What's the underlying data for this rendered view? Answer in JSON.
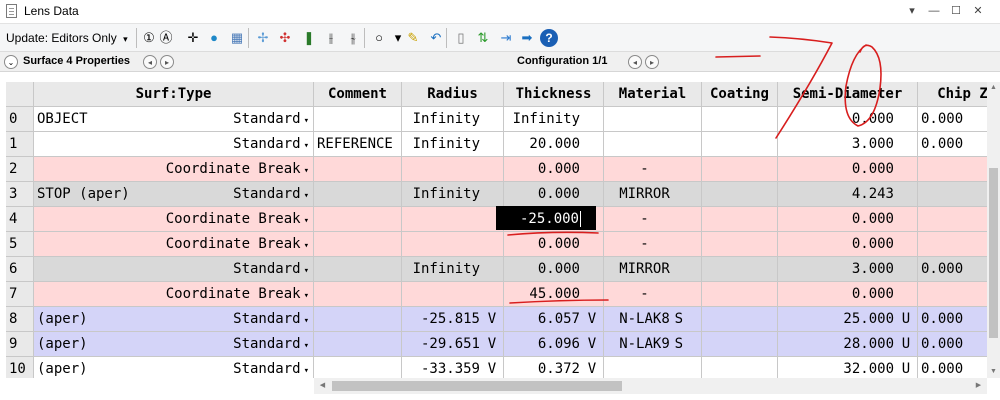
{
  "window": {
    "title": "Lens Data",
    "controls": [
      "▾",
      "—",
      "☐",
      "✕"
    ]
  },
  "toolbar": {
    "update_label": "Update: Editors Only",
    "dropdown_glyph": "▾",
    "icons": [
      {
        "name": "constant-1-icon",
        "glyph": "①",
        "color": "#000000"
      },
      {
        "name": "constant-a-icon",
        "glyph": "Ⓐ",
        "color": "#000000"
      },
      {
        "name": "crosshair-icon",
        "glyph": "✛",
        "color": "#000000"
      },
      {
        "name": "globe-icon",
        "glyph": "●",
        "color": "#1e88c8"
      },
      {
        "name": "map-icon",
        "glyph": "▦",
        "color": "#4a7ab8"
      },
      {
        "name": "insert-surface-icon",
        "glyph": "✢",
        "color": "#5b9bd5"
      },
      {
        "name": "delete-surface-icon",
        "glyph": "✣",
        "color": "#d03030"
      },
      {
        "name": "lens-group-icon",
        "glyph": "❚",
        "color": "#2a7a2a"
      },
      {
        "name": "fold-mirror-icon",
        "glyph": "⫲",
        "color": "#333333"
      },
      {
        "name": "tilt-decenter-icon",
        "glyph": "⫳",
        "color": "#333333"
      },
      {
        "name": "ring-icon",
        "glyph": "○",
        "color": "#000000"
      },
      {
        "name": "dropdown-arrow-icon",
        "glyph": "▾",
        "color": "#000000"
      },
      {
        "name": "edit-pencil-icon",
        "glyph": "✎",
        "color": "#c8a000"
      },
      {
        "name": "undo-arrow-icon",
        "glyph": "↶",
        "color": "#1a6fc0"
      },
      {
        "name": "page-icon",
        "glyph": "▯",
        "color": "#777777"
      },
      {
        "name": "swap-arrows-icon",
        "glyph": "⇅",
        "color": "#2a9a2a"
      },
      {
        "name": "arrows-in-icon",
        "glyph": "⇥",
        "color": "#2a7ad0"
      },
      {
        "name": "right-arrow-icon",
        "glyph": "➡",
        "color": "#1a6fc0"
      },
      {
        "name": "help-icon",
        "glyph": "?",
        "color": "#ffffff"
      }
    ]
  },
  "subbar": {
    "collapse_glyph": "⌄",
    "properties_label": "Surface 4 Properties",
    "configuration_label": "Configuration 1/1",
    "prev_glyph": "◂",
    "next_glyph": "▸"
  },
  "table": {
    "columns": [
      "Surf:Type",
      "Comment",
      "Radius",
      "Thickness",
      "Material",
      "Coating",
      "Semi-Diameter",
      "Chip Z"
    ],
    "rows": [
      {
        "idx": "0",
        "name": "OBJECT",
        "type": "Standard",
        "comment": "",
        "radius": "Infinity",
        "radius_flag": "",
        "thickness": "Infinity",
        "thickness_flag": "",
        "material": "",
        "material_flag": "",
        "coating": "",
        "semi": "0.000",
        "semi_flag": "",
        "chip": "0.000",
        "bg": "#ffffff"
      },
      {
        "idx": "1",
        "name": "",
        "type": "Standard",
        "comment": "REFERENCE",
        "radius": "Infinity",
        "radius_flag": "",
        "thickness": "20.000",
        "thickness_flag": "",
        "material": "",
        "material_flag": "",
        "coating": "",
        "semi": "3.000",
        "semi_flag": "",
        "chip": "0.000",
        "bg": "#ffffff"
      },
      {
        "idx": "2",
        "name": "",
        "type": "Coordinate Break",
        "comment": "",
        "radius": "",
        "radius_flag": "",
        "thickness": "0.000",
        "thickness_flag": "",
        "material": "-",
        "material_flag": "",
        "coating": "",
        "semi": "0.000",
        "semi_flag": "",
        "chip": "",
        "bg": "#ffd9d9"
      },
      {
        "idx": "3",
        "name": "STOP (aper)",
        "type": "Standard",
        "comment": "",
        "radius": "Infinity",
        "radius_flag": "",
        "thickness": "0.000",
        "thickness_flag": "",
        "material": "MIRROR",
        "material_flag": "",
        "coating": "",
        "semi": "4.243",
        "semi_flag": "",
        "chip": "",
        "bg": "#d9d9d9"
      },
      {
        "idx": "4",
        "name": "",
        "type": "Coordinate Break",
        "comment": "",
        "radius": "",
        "radius_flag": "",
        "thickness": "-25.000",
        "thickness_flag": "",
        "material": "-",
        "material_flag": "",
        "coating": "",
        "semi": "0.000",
        "semi_flag": "",
        "chip": "",
        "bg": "#ffd9d9"
      },
      {
        "idx": "5",
        "name": "",
        "type": "Coordinate Break",
        "comment": "",
        "radius": "",
        "radius_flag": "",
        "thickness": "0.000",
        "thickness_flag": "",
        "material": "-",
        "material_flag": "",
        "coating": "",
        "semi": "0.000",
        "semi_flag": "",
        "chip": "",
        "bg": "#ffd9d9"
      },
      {
        "idx": "6",
        "name": "",
        "type": "Standard",
        "comment": "",
        "radius": "Infinity",
        "radius_flag": "",
        "thickness": "0.000",
        "thickness_flag": "",
        "material": "MIRROR",
        "material_flag": "",
        "coating": "",
        "semi": "3.000",
        "semi_flag": "",
        "chip": "0.000",
        "bg": "#d9d9d9"
      },
      {
        "idx": "7",
        "name": "",
        "type": "Coordinate Break",
        "comment": "",
        "radius": "",
        "radius_flag": "",
        "thickness": "45.000",
        "thickness_flag": "",
        "material": "-",
        "material_flag": "",
        "coating": "",
        "semi": "0.000",
        "semi_flag": "",
        "chip": "",
        "bg": "#ffd9d9"
      },
      {
        "idx": "8",
        "name": "(aper)",
        "type": "Standard",
        "comment": "",
        "radius": "-25.815",
        "radius_flag": "V",
        "thickness": "6.057",
        "thickness_flag": "V",
        "material": "N-LAK8",
        "material_flag": "S",
        "coating": "",
        "semi": "25.000",
        "semi_flag": "U",
        "chip": "0.000",
        "bg": "#d4d4f8"
      },
      {
        "idx": "9",
        "name": "(aper)",
        "type": "Standard",
        "comment": "",
        "radius": "-29.651",
        "radius_flag": "V",
        "thickness": "6.096",
        "thickness_flag": "V",
        "material": "N-LAK9",
        "material_flag": "S",
        "coating": "",
        "semi": "28.000",
        "semi_flag": "U",
        "chip": "0.000",
        "bg": "#d4d4f8"
      },
      {
        "idx": "10",
        "name": "(aper)",
        "type": "Standard",
        "comment": "",
        "radius": "-33.359",
        "radius_flag": "V",
        "thickness": "0.372",
        "thickness_flag": "V",
        "material": "",
        "material_flag": "",
        "coating": "",
        "semi": "32.000",
        "semi_flag": "U",
        "chip": "0.000",
        "bg": "#ffffff"
      }
    ]
  },
  "editing_cell": {
    "row": 4,
    "value": "-25.000"
  },
  "annotation_color": "#d81e1e"
}
